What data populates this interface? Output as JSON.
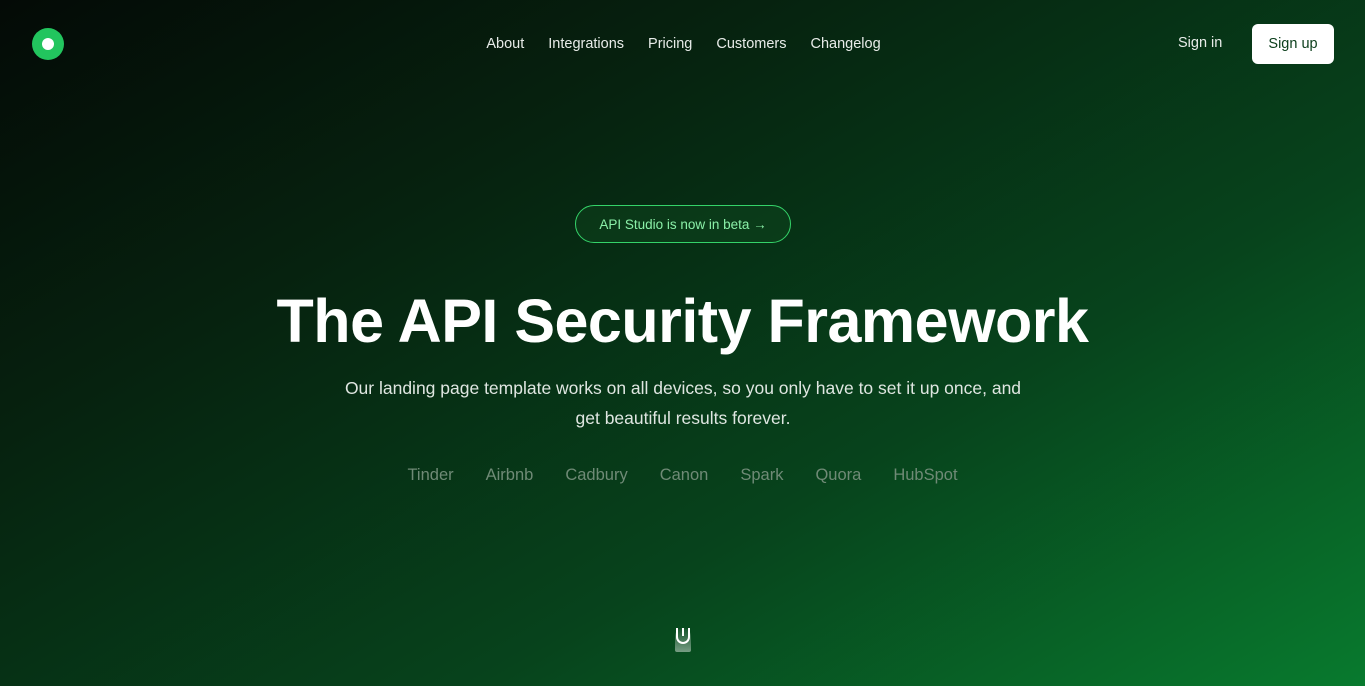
{
  "nav": {
    "items": [
      {
        "label": "About"
      },
      {
        "label": "Integrations"
      },
      {
        "label": "Pricing"
      },
      {
        "label": "Customers"
      },
      {
        "label": "Changelog"
      }
    ],
    "sign_in": "Sign in",
    "sign_up": "Sign up"
  },
  "hero": {
    "badge": "API Studio is now in beta →",
    "title": "The API Security Framework",
    "subtitle": "Our landing page template works on all devices, so you only have to set it up once, and get beautiful results forever.",
    "brands": [
      "Tinder",
      "Airbnb",
      "Cadbury",
      "Canon",
      "Spark",
      "Quora",
      "HubSpot"
    ]
  },
  "colors": {
    "accent": "#22c55e",
    "badge_text": "#8af0a8",
    "bg_dark": "#040a06",
    "bg_green": "#087a2e"
  },
  "icons": {
    "logo": "logo-circle-icon",
    "scroll": "scroll-mouse-icon"
  }
}
